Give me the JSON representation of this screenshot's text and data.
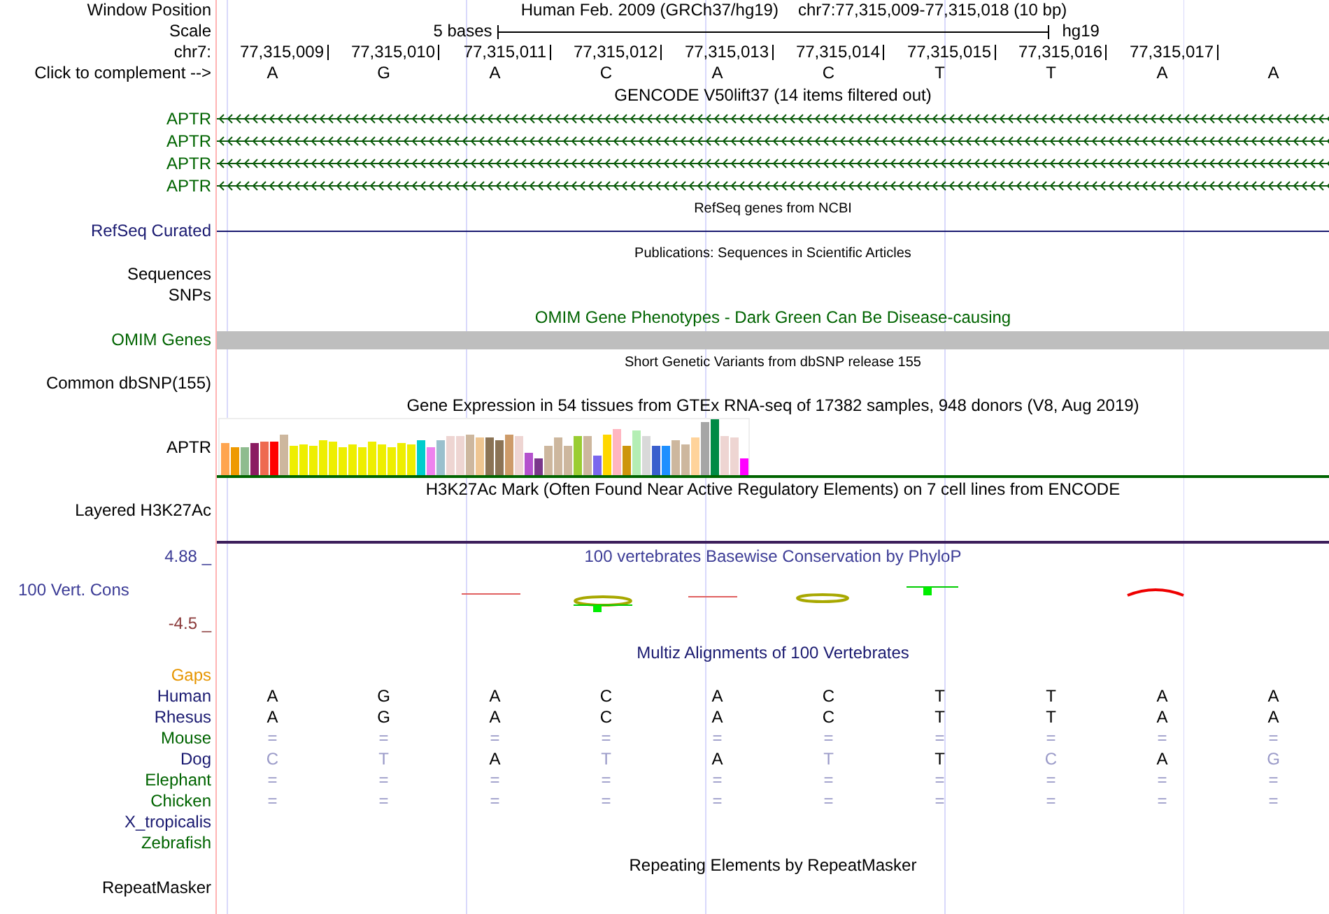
{
  "header": {
    "window_label": "Window Position",
    "assembly": "Human Feb. 2009 (GRCh37/hg19)",
    "position": "chr7:77,315,009-77,315,018 (10 bp)",
    "scale_label": "Scale",
    "scale_text": "5 bases",
    "scale_db": "hg19",
    "chrom_label": "chr7:",
    "positions": [
      "77,315,009",
      "77,315,010",
      "77,315,011",
      "77,315,012",
      "77,315,013",
      "77,315,014",
      "77,315,015",
      "77,315,016",
      "77,315,017"
    ],
    "complement_label": "Click to complement -->",
    "bases": [
      "A",
      "G",
      "A",
      "C",
      "A",
      "C",
      "T",
      "T",
      "A",
      "A"
    ]
  },
  "tracks": [
    {
      "kind": "title",
      "text": "GENCODE V50lift37 (14 items filtered out)",
      "color": "#000000"
    },
    {
      "kind": "gene",
      "label": "APTR",
      "color": "#006400"
    },
    {
      "kind": "gene",
      "label": "APTR",
      "color": "#006400"
    },
    {
      "kind": "gene",
      "label": "APTR",
      "color": "#006400"
    },
    {
      "kind": "gene",
      "label": "APTR",
      "color": "#006400"
    },
    {
      "kind": "subtitle",
      "text": "RefSeq genes from NCBI",
      "color": "#000000"
    },
    {
      "kind": "line",
      "label": "RefSeq Curated",
      "color": "#191970"
    },
    {
      "kind": "subtitle",
      "text": "Publications: Sequences in Scientific Articles",
      "color": "#000000"
    },
    {
      "kind": "label",
      "label": "Sequences",
      "color": "#000000"
    },
    {
      "kind": "label",
      "label": "SNPs",
      "color": "#000000"
    },
    {
      "kind": "title",
      "text": "OMIM Gene Phenotypes - Dark Green Can Be Disease-causing",
      "color": "#006400"
    },
    {
      "kind": "bar",
      "label": "OMIM Genes",
      "color": "#006400"
    },
    {
      "kind": "subtitle",
      "text": "Short Genetic Variants from dbSNP release 155",
      "color": "#000000"
    },
    {
      "kind": "label",
      "label": "Common dbSNP(155)",
      "color": "#000000"
    },
    {
      "kind": "title",
      "text": "Gene Expression in 54 tissues from GTEx RNA-seq of 17382 samples, 948 donors (V8, Aug 2019)",
      "color": "#000000"
    },
    {
      "kind": "expression",
      "label": "APTR",
      "color": "#000000"
    },
    {
      "kind": "title",
      "text": "H3K27Ac Mark (Often Found Near Active Regulatory Elements) on 7 cell lines from ENCODE",
      "color": "#000000"
    },
    {
      "kind": "density",
      "label": "Layered H3K27Ac",
      "color": "#000000"
    },
    {
      "kind": "conservation",
      "max": "4.88 _",
      "label": "100 Vert. Cons",
      "min": "-4.5 _",
      "title": "100 vertebrates Basewise Conservation by PhyloP",
      "color": "#3c3c96"
    },
    {
      "kind": "title",
      "text": "Multiz Alignments of 100 Vertebrates",
      "color": "#191970"
    },
    {
      "kind": "label",
      "label": "Gaps",
      "color": "#e69500"
    },
    {
      "kind": "alignment",
      "label": "Human",
      "color": "#191970",
      "bases": [
        "A",
        "G",
        "A",
        "C",
        "A",
        "C",
        "T",
        "T",
        "A",
        "A"
      ]
    },
    {
      "kind": "alignment",
      "label": "Rhesus",
      "color": "#191970",
      "bases": [
        "A",
        "G",
        "A",
        "C",
        "A",
        "C",
        "T",
        "T",
        "A",
        "A"
      ]
    },
    {
      "kind": "alignment",
      "label": "Mouse",
      "color": "#006400",
      "bases": [
        "=",
        "=",
        "=",
        "=",
        "=",
        "=",
        "=",
        "=",
        "=",
        "="
      ]
    },
    {
      "kind": "alignment",
      "label": "Dog",
      "color": "#191970",
      "bases": [
        "C",
        "T",
        "A",
        "T",
        "A",
        "T",
        "T",
        "C",
        "A",
        "G"
      ]
    },
    {
      "kind": "alignment",
      "label": "Elephant",
      "color": "#006400",
      "bases": [
        "=",
        "=",
        "=",
        "=",
        "=",
        "=",
        "=",
        "=",
        "=",
        "="
      ]
    },
    {
      "kind": "alignment",
      "label": "Chicken",
      "color": "#006400",
      "bases": [
        "=",
        "=",
        "=",
        "=",
        "=",
        "=",
        "=",
        "=",
        "=",
        "="
      ]
    },
    {
      "kind": "alignment",
      "label": "X_tropicalis",
      "color": "#191970"
    },
    {
      "kind": "alignment",
      "label": "Zebrafish",
      "color": "#006400"
    },
    {
      "kind": "title",
      "text": "Repeating Elements by RepeatMasker",
      "color": "#000000"
    },
    {
      "kind": "label",
      "label": "RepeatMasker",
      "color": "#000000"
    }
  ]
}
